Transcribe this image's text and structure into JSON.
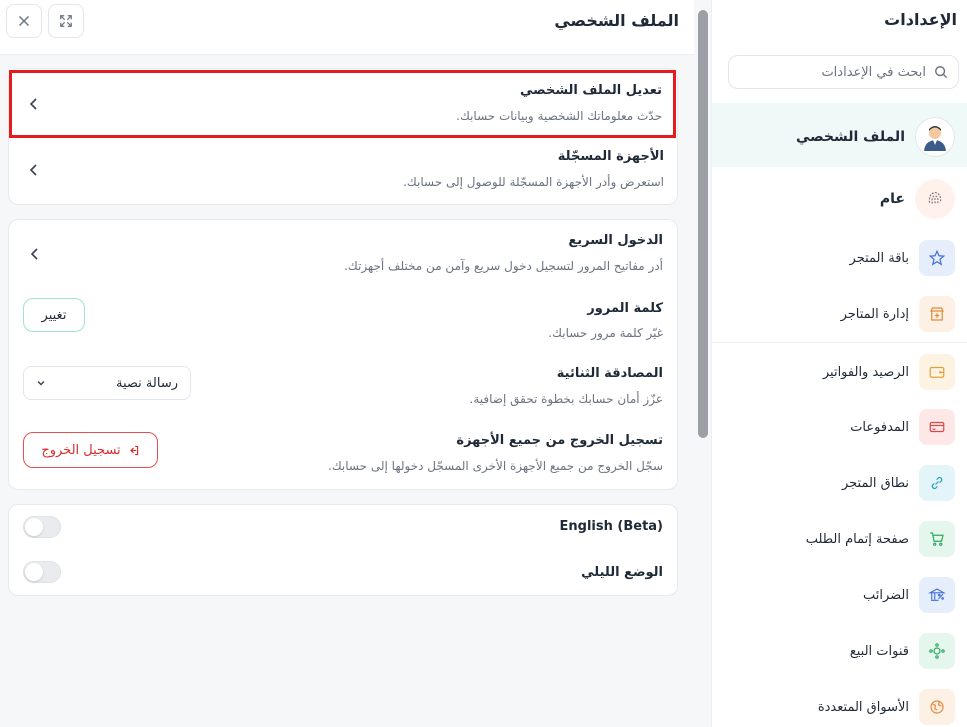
{
  "sidebar": {
    "title": "الإعدادات",
    "search_placeholder": "ابحث في الإعدادات",
    "items": [
      {
        "label": "الملف الشخصي",
        "icon": "profile-avatar-icon"
      },
      {
        "label": "عام",
        "icon": "fingerprint-icon"
      },
      {
        "label": "باقة المتجر",
        "icon": "star-icon"
      },
      {
        "label": "إدارة المتاجر",
        "icon": "store-manage-icon"
      },
      {
        "label": "الرصيد والفواتير",
        "icon": "wallet-icon"
      },
      {
        "label": "المدفوعات",
        "icon": "card-icon"
      },
      {
        "label": "نطاق المتجر",
        "icon": "link-icon"
      },
      {
        "label": "صفحة إتمام الطلب",
        "icon": "cart-icon"
      },
      {
        "label": "الضرائب",
        "icon": "tax-icon"
      },
      {
        "label": "قنوات البيع",
        "icon": "channels-icon"
      },
      {
        "label": "الأسواق المتعددة",
        "icon": "globe-icon"
      }
    ]
  },
  "header": {
    "title": "الملف الشخصي"
  },
  "account": {
    "edit_title": "تعديل الملف الشخصي",
    "edit_desc": "حدّث معلوماتك الشخصية وبيانات حسابك.",
    "devices_title": "الأجهزة المسجّلة",
    "devices_desc": "استعرض وأدر الأجهزة المسجّلة للوصول إلى حسابك."
  },
  "security": {
    "quick_title": "الدخول السريع",
    "quick_desc": "أدر مفاتيح المرور لتسجيل دخول سريع وآمن من مختلف أجهزتك.",
    "password_title": "كلمة المرور",
    "password_desc": "غيّر كلمة مرور حسابك.",
    "change_label": "تغيير",
    "twofa_title": "المصادقة الثنائية",
    "twofa_desc": "عزّز أمان حسابك بخطوة تحقق إضافية.",
    "twofa_value": "رسالة نصية",
    "logout_all_title": "تسجيل الخروج من جميع الأجهزة",
    "logout_all_desc": "سجّل الخروج من جميع الأجهزة الأخرى المسجّل دخولها إلى حسابك.",
    "logout_label": "تسجيل الخروج"
  },
  "preferences": {
    "english_label": "English (Beta)",
    "english_enabled": false,
    "dark_label": "الوضع الليلي",
    "dark_enabled": false
  }
}
